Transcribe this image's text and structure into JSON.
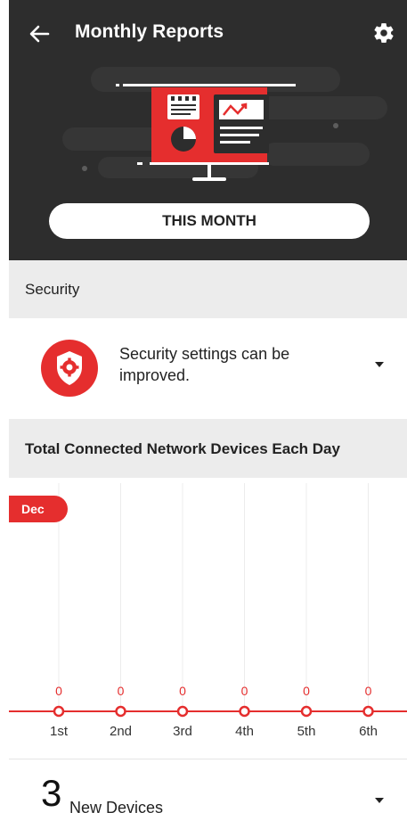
{
  "header": {
    "title": "Monthly Reports",
    "period_button": "THIS MONTH"
  },
  "icons": {
    "back": "arrow-left-icon",
    "settings": "gear-icon",
    "shield": "shield-gear-icon",
    "expand": "caret-down-icon"
  },
  "colors": {
    "accent": "#e52e2e",
    "header_bg": "#2d2d2d",
    "section_bg": "#ececec"
  },
  "security": {
    "heading": "Security",
    "message": "Security settings can be improved."
  },
  "devices_chart": {
    "heading": "Total Connected Network Devices Each Day",
    "month_tag": "Dec"
  },
  "chart_data": {
    "type": "line",
    "title": "Total Connected Network Devices Each Day",
    "month": "Dec",
    "categories": [
      "1st",
      "2nd",
      "3rd",
      "4th",
      "5th",
      "6th"
    ],
    "values": [
      0,
      0,
      0,
      0,
      0,
      0
    ],
    "grid": true
  },
  "new_devices": {
    "count": "3",
    "label": "New Devices"
  }
}
